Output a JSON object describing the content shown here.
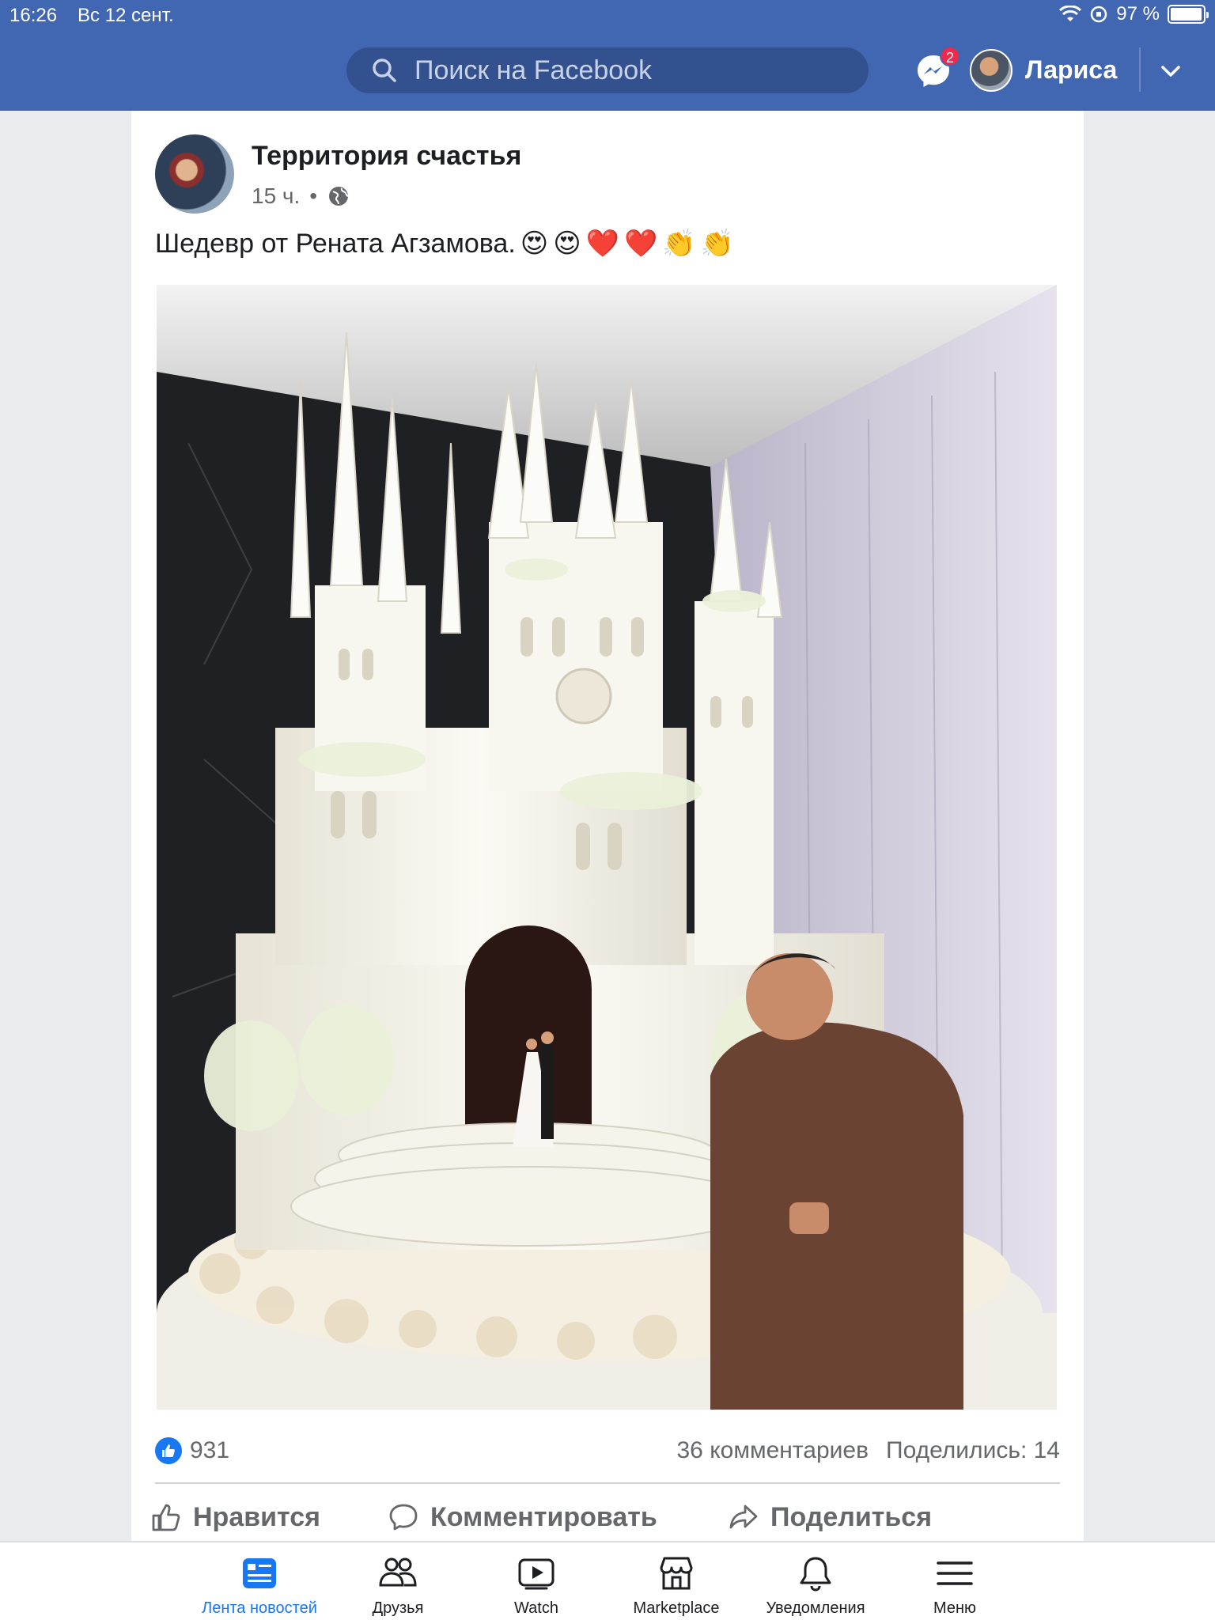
{
  "status_bar": {
    "time": "16:26",
    "date": "Вс 12 сент.",
    "battery": "97 %",
    "battery_level": 0.97
  },
  "header": {
    "search_placeholder": "Поиск на Facebook",
    "messenger_badge": "2",
    "username": "Лариса",
    "brand_color": "#4267b2",
    "icons": [
      "search-icon",
      "messenger-icon",
      "avatar",
      "chevron-down-icon"
    ]
  },
  "post": {
    "page_name": "Территория счастья",
    "time": "15 ч.",
    "separator": "•",
    "visibility_icon": "globe-icon",
    "text": "Шедевр от Рената Агзамова.",
    "emojis": [
      "😍",
      "😍",
      "❤️",
      "❤️",
      "👏",
      "👏"
    ],
    "image_alt_icon": "photo"
  },
  "stats": {
    "likes": "931",
    "comments": "36 комментариев",
    "shares": "Поделились: 14"
  },
  "actions": {
    "like": "Нравится",
    "comment": "Комментировать",
    "share": "Поделиться"
  },
  "bottom_nav": {
    "items": [
      {
        "label": "Лента новостей",
        "icon": "news-feed-icon",
        "active": true
      },
      {
        "label": "Друзья",
        "icon": "friends-icon",
        "active": false
      },
      {
        "label": "Watch",
        "icon": "watch-icon",
        "active": false
      },
      {
        "label": "Marketplace",
        "icon": "marketplace-icon",
        "active": false
      },
      {
        "label": "Уведомления",
        "icon": "bell-icon",
        "active": false
      },
      {
        "label": "Меню",
        "icon": "menu-icon",
        "active": false
      }
    ],
    "accent_color": "#1877f2"
  }
}
